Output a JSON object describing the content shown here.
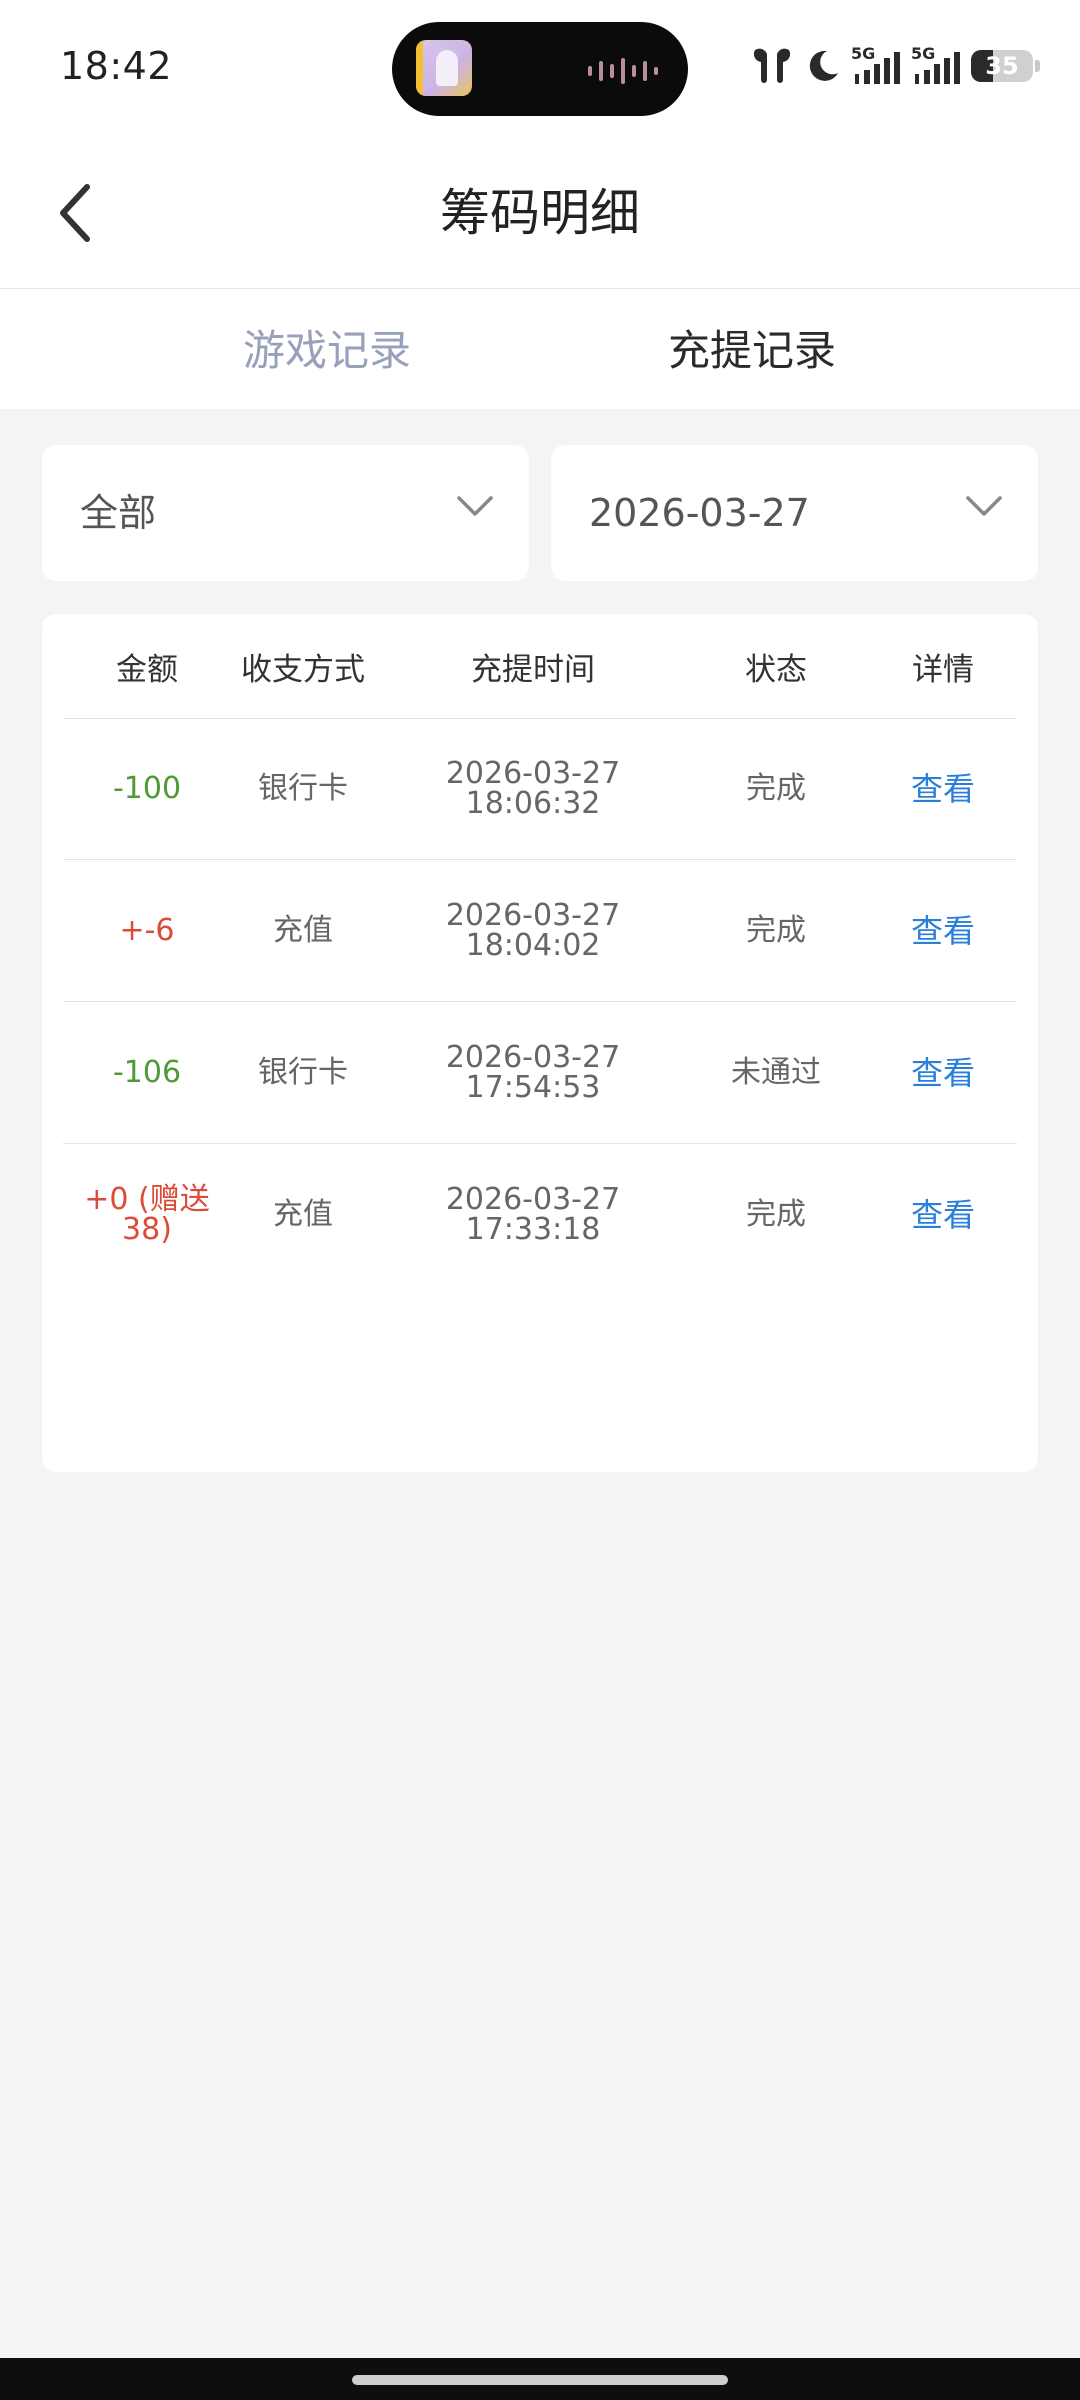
{
  "status_bar": {
    "time": "18:42",
    "network_1": "5G",
    "network_2": "5G",
    "battery": "35"
  },
  "header": {
    "title": "筹码明细"
  },
  "tabs": [
    {
      "label": "游戏记录",
      "active": false
    },
    {
      "label": "充提记录",
      "active": true
    }
  ],
  "filters": {
    "type": "全部",
    "date": "2026-03-27"
  },
  "table": {
    "headers": {
      "amount": "金额",
      "method": "收支方式",
      "time": "充提时间",
      "status": "状态",
      "detail": "详情"
    },
    "rows": [
      {
        "amount": "-100",
        "method": "银行卡",
        "date": "2026-03-27",
        "clock": "18:06:32",
        "status": "完成",
        "detail": "查看"
      },
      {
        "amount": "+-6",
        "method": "充值",
        "date": "2026-03-27",
        "clock": "18:04:02",
        "status": "完成",
        "detail": "查看"
      },
      {
        "amount": "-106",
        "method": "银行卡",
        "date": "2026-03-27",
        "clock": "17:54:53",
        "status": "未通过",
        "detail": "查看"
      },
      {
        "amount": "+0 (赠送38)",
        "method": "充值",
        "date": "2026-03-27",
        "clock": "17:33:18",
        "status": "完成",
        "detail": "查看"
      }
    ]
  },
  "colors": {
    "negative_amount": "#4f9a35",
    "positive_amount": "#dc4a38",
    "link": "#2a7fd9",
    "inactive_tab": "#97a1ba",
    "page_background": "#f4f4f4"
  },
  "icons": {
    "back": "chevron-left-icon",
    "dropdown": "chevron-down-icon",
    "headphones": "earbuds-icon",
    "dnd": "moon-icon",
    "signal": "signal-icon",
    "battery": "battery-icon"
  }
}
